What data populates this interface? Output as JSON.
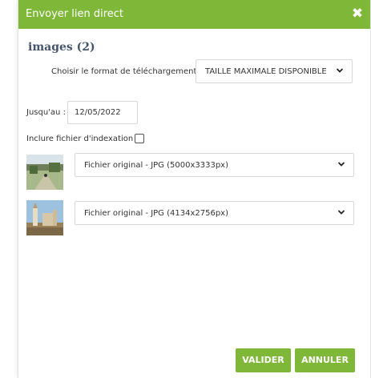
{
  "dialog": {
    "title": "Envoyer lien direct",
    "close_icon": "close-icon"
  },
  "images_heading": "images (2)",
  "format": {
    "label": "Choisir le format de téléchargement",
    "selected": "TAILLE MAXIMALE DISPONIBLE"
  },
  "until": {
    "label": "Jusqu'au :",
    "value": "12/05/2022"
  },
  "index": {
    "label": "Inclure fichier d'indexation :",
    "checked": false
  },
  "files": [
    {
      "option": "Fichier original - JPG (5000x3333px)",
      "thumb_icon": "landscape-thumbnail"
    },
    {
      "option": "Fichier original - JPG (4134x2756px)",
      "thumb_icon": "building-thumbnail"
    }
  ],
  "buttons": {
    "validate": "VALIDER",
    "cancel": "ANNULER"
  },
  "colors": {
    "accent": "#7fb839",
    "heading": "#44546a"
  }
}
